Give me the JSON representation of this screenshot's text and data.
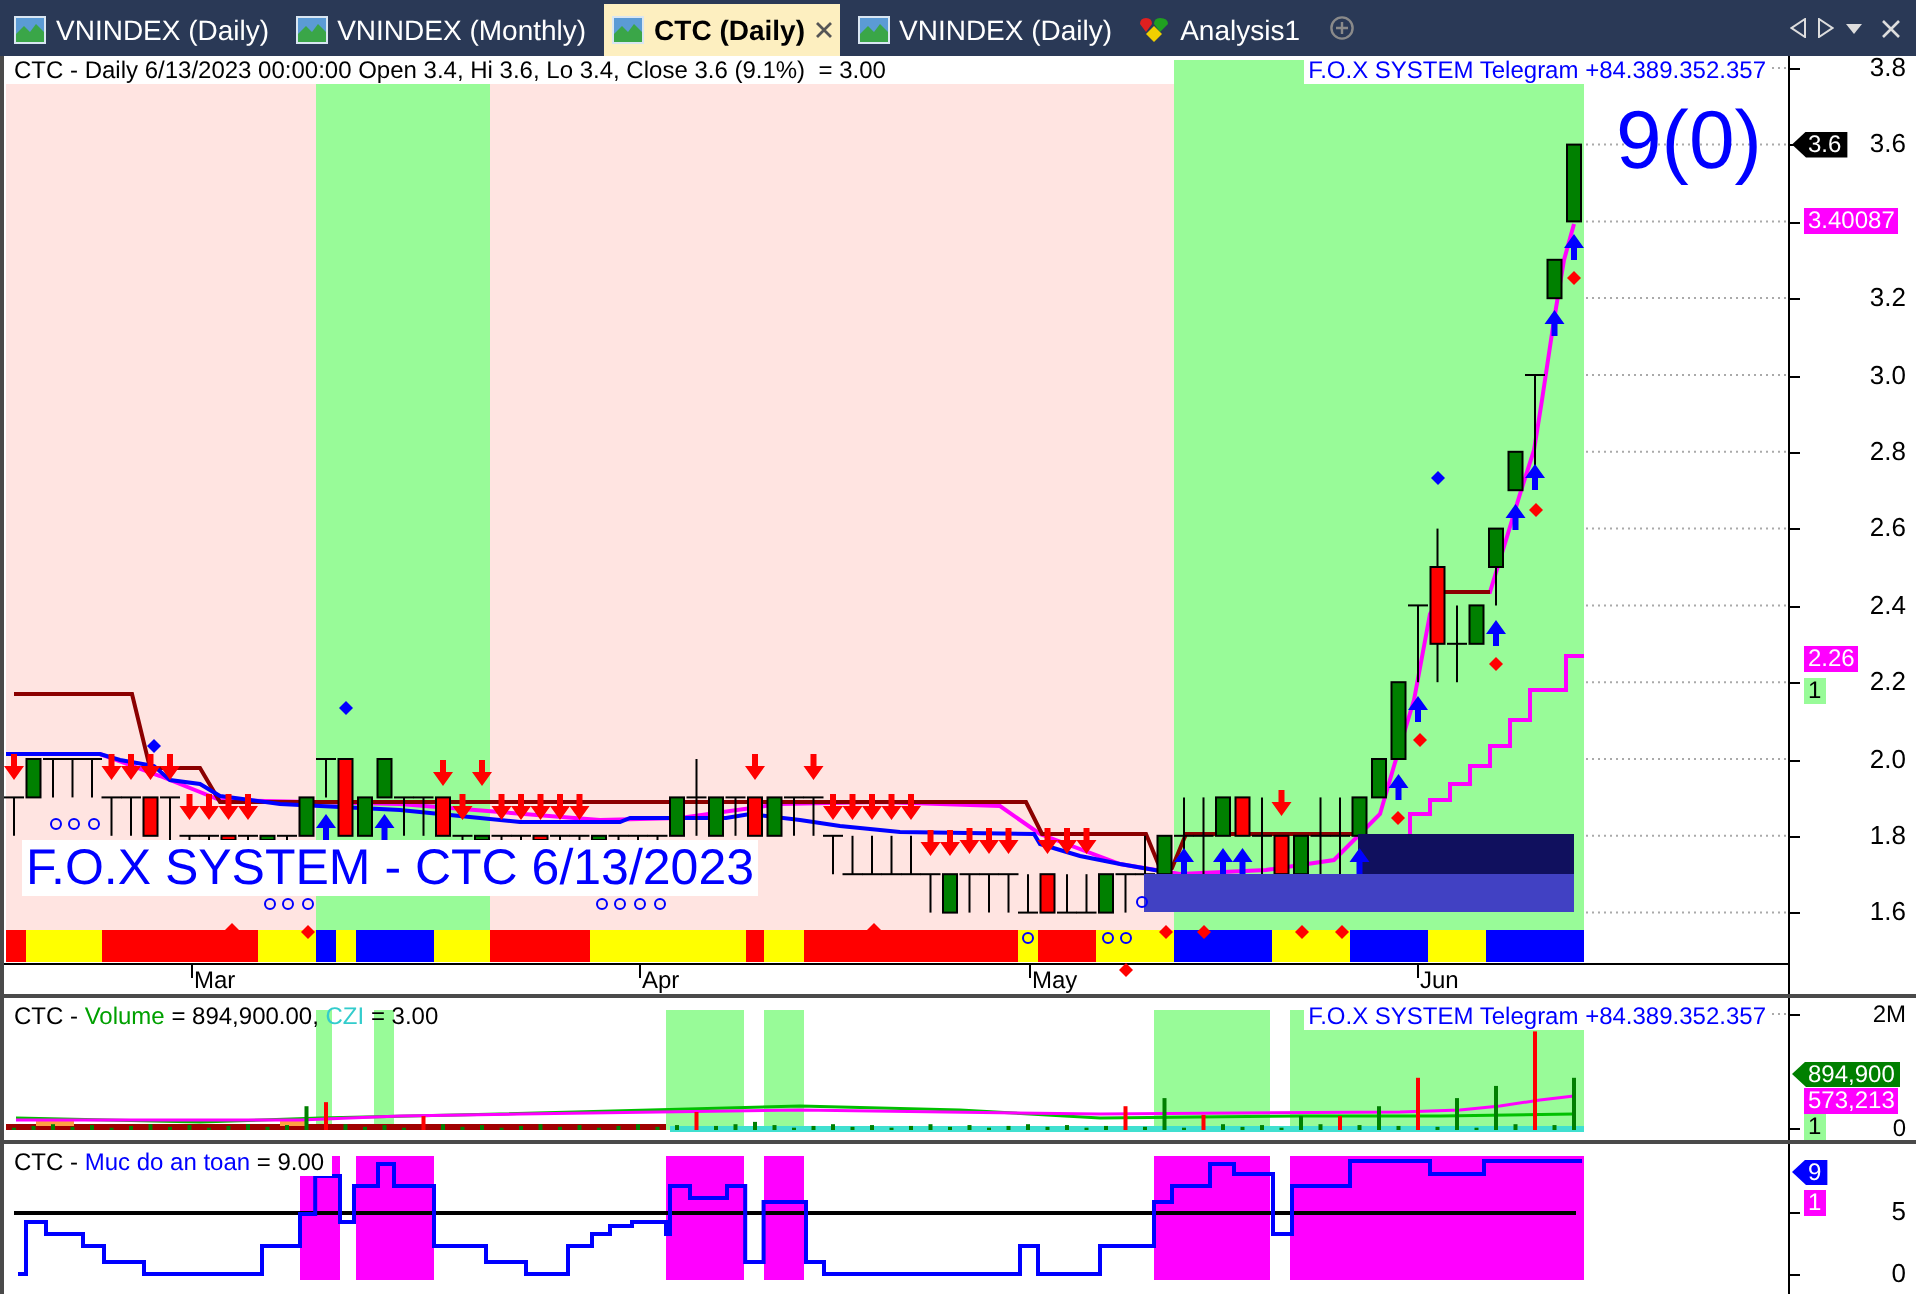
{
  "tabs": [
    {
      "label": "VNINDEX (Daily)",
      "kind": "chart",
      "selected": false
    },
    {
      "label": "VNINDEX (Monthly)",
      "kind": "chart",
      "selected": false
    },
    {
      "label": "CTC (Daily)",
      "kind": "chart",
      "selected": true
    },
    {
      "label": "VNINDEX (Daily)",
      "kind": "chart",
      "selected": false
    },
    {
      "label": "Analysis1",
      "kind": "analysis",
      "selected": false
    }
  ],
  "price_pane": {
    "legend": "CTC - Daily 6/13/2023 00:00:00 Open 3.4, Hi 3.6, Lo 3.4, Close 3.6 (9.1%)  = 3.00",
    "contact": "F.O.X SYSTEM Telegram +84.389.352.357",
    "signal_label": "9(0)",
    "title_overlay": "F.O.X SYSTEM - CTC 6/13/2023",
    "y_axis": [
      "3.8",
      "3.6",
      "3.2",
      "3.0",
      "2.8",
      "2.6",
      "2.4",
      "2.2",
      "2.0",
      "1.8",
      "1.6"
    ],
    "price_tags": [
      {
        "text": "3.6",
        "kind": "pointer",
        "color": "#000000"
      },
      {
        "text": "3.40087",
        "kind": "plain",
        "color": "#ff00ff"
      },
      {
        "text": "2.26",
        "kind": "plain",
        "color": "#ff00ff"
      },
      {
        "text": "1",
        "kind": "plain",
        "color": "#98fb98"
      }
    ],
    "x_axis": [
      "Mar",
      "Apr",
      "May",
      "Jun"
    ]
  },
  "volume_pane": {
    "legend": [
      {
        "text": "CTC - ",
        "color": "#000000"
      },
      {
        "text": "Volume",
        "color": "#00a000"
      },
      {
        "text": " = 894,900.00, ",
        "color": "#000000"
      },
      {
        "text": "CZI",
        "color": "#33cccc"
      },
      {
        "text": " = 3.00",
        "color": "#000000"
      }
    ],
    "contact": "F.O.X SYSTEM Telegram +84.389.352.357",
    "y_axis": [
      "2M",
      "0"
    ],
    "value_tags": [
      {
        "text": "894,900",
        "kind": "pointer",
        "color": "#008000"
      },
      {
        "text": "573,213",
        "kind": "plain",
        "color": "#ff00ff"
      },
      {
        "text": "1",
        "kind": "plain",
        "color": "#98fb98"
      }
    ]
  },
  "safety_pane": {
    "legend": [
      {
        "text": "CTC - ",
        "color": "#000000"
      },
      {
        "text": "Muc do an toan",
        "color": "#0000ff"
      },
      {
        "text": " = 9.00",
        "color": "#000000"
      }
    ],
    "y_axis": [
      "5",
      "0"
    ],
    "value_tags": [
      {
        "text": "9",
        "kind": "pointer",
        "color": "#0000ff"
      },
      {
        "text": "1",
        "kind": "plain",
        "color": "#ff00ff"
      }
    ]
  }
}
